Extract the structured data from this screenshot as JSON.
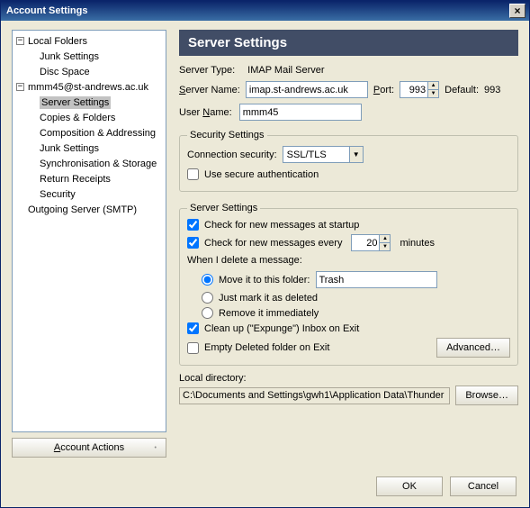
{
  "window": {
    "title": "Account Settings",
    "close_icon": "×"
  },
  "tree": {
    "local_folders": "Local Folders",
    "lf_junk": "Junk Settings",
    "lf_disc": "Disc Space",
    "account": "mmm45@st-andrews.ac.uk",
    "ac_server": "Server Settings",
    "ac_copies": "Copies & Folders",
    "ac_comp": "Composition & Addressing",
    "ac_junk": "Junk Settings",
    "ac_sync": "Synchronisation & Storage",
    "ac_rr": "Return Receipts",
    "ac_sec": "Security",
    "smtp": "Outgoing Server (SMTP)",
    "actions_label": "Account Actions"
  },
  "panel": {
    "heading": "Server Settings",
    "server_type_lbl": "Server Type:",
    "server_type_val": "IMAP Mail Server",
    "server_name_lbl_pre": "S",
    "server_name_lbl_post": "erver Name:",
    "server_name_val": "imap.st-andrews.ac.uk",
    "port_lbl_pre": "P",
    "port_lbl_post": "ort:",
    "port_val": "993",
    "default_lbl": "Default:",
    "default_val": "993",
    "user_lbl_pre": "User ",
    "user_lbl_mid": "N",
    "user_lbl_post": "ame:",
    "user_val": "mmm45"
  },
  "security_group": {
    "legend": "Security Settings",
    "conn_lbl": "Connection security:",
    "conn_val": "SSL/TLS",
    "secure_auth_lbl": "Use secure authentication"
  },
  "server_group": {
    "legend": "Server Settings",
    "chk_startup": "Check for new messages at startup",
    "chk_every_pre": "Check for new messages every",
    "chk_every_post": "minutes",
    "chk_every_val": "20",
    "when_delete": "When I delete a message:",
    "opt_move": "Move it to this folder:",
    "move_val": "Trash",
    "opt_mark": "Just mark it as deleted",
    "opt_remove": "Remove it immediately",
    "chk_expunge": "Clean up (\"Expunge\") Inbox on Exit",
    "chk_empty": "Empty Deleted folder on Exit",
    "adv_btn": "Advanced…"
  },
  "localdir": {
    "label": "Local directory:",
    "value": "C:\\Documents and Settings\\gwh1\\Application Data\\Thunder",
    "browse": "Browse…"
  },
  "footer": {
    "ok": "OK",
    "cancel": "Cancel"
  }
}
